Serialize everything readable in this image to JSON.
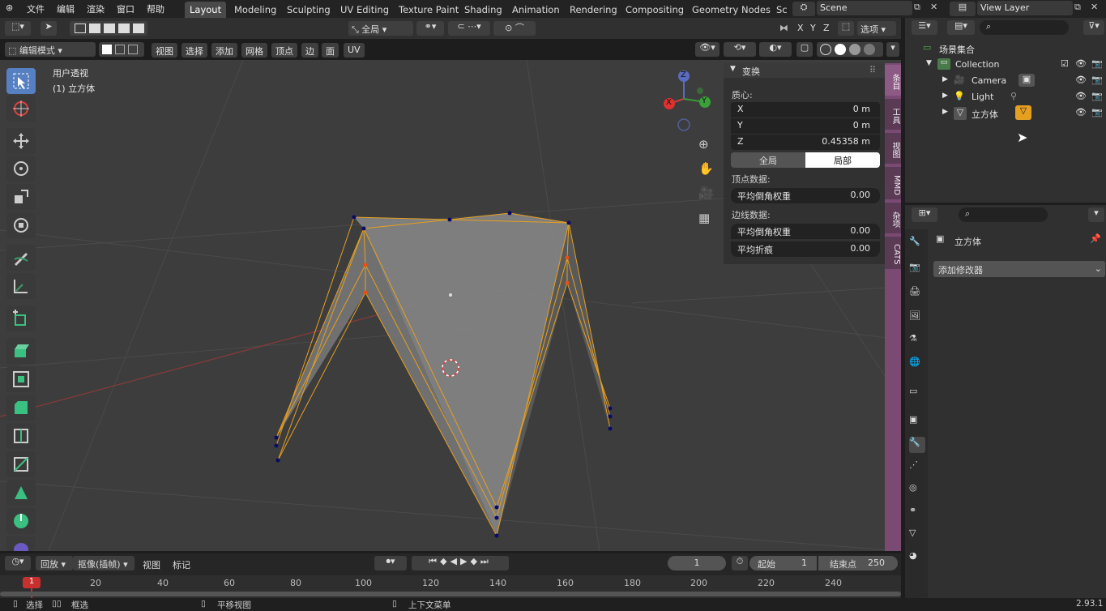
{
  "menu": {
    "file": "文件",
    "edit": "编辑",
    "render": "渲染",
    "window": "窗口",
    "help": "帮助"
  },
  "workspaces": [
    "Layout",
    "Modeling",
    "Sculpting",
    "UV Editing",
    "Texture Paint",
    "Shading",
    "Animation",
    "Rendering",
    "Compositing",
    "Geometry Nodes",
    "Sc"
  ],
  "scene": {
    "name": "Scene",
    "view_layer": "View Layer"
  },
  "viewport_header": {
    "orientation": "全局",
    "options": "选项",
    "mode": "编辑模式",
    "menus": [
      "视图",
      "选择",
      "添加",
      "网格",
      "顶点",
      "边",
      "面",
      "UV"
    ],
    "axes": [
      "X",
      "Y",
      "Z"
    ]
  },
  "viewport": {
    "view_name": "用户透视",
    "object_label": "(1) 立方体"
  },
  "gizmo": {
    "x": "X",
    "y": "Y",
    "z": "Z"
  },
  "npanel": {
    "title": "变换",
    "median_label": "质心:",
    "x_label": "X",
    "x_value": "0 m",
    "y_label": "Y",
    "y_value": "0 m",
    "z_label": "Z",
    "z_value": "0.45358 m",
    "global_btn": "全局",
    "local_btn": "局部",
    "vertex_data": "顶点数据:",
    "bevel_weight_v_label": "平均倒角权重",
    "bevel_weight_v": "0.00",
    "edge_data": "边线数据:",
    "bevel_weight_e_label": "平均倒角权重",
    "bevel_weight_e": "0.00",
    "crease_label": "平均折痕",
    "crease": "0.00"
  },
  "side_tabs": [
    "条目",
    "工具",
    "视图",
    "MMD",
    "杂项",
    "CATS"
  ],
  "outliner": {
    "root": "场景集合",
    "collection": "Collection",
    "items": [
      "Camera",
      "Light",
      "立方体"
    ]
  },
  "properties": {
    "object_name": "立方体",
    "add_modifier": "添加修改器"
  },
  "timeline": {
    "playback": "回放",
    "keying": "抠像(插帧)",
    "view": "视图",
    "marker": "标记",
    "current_frame": "1",
    "start_label": "起始",
    "start": "1",
    "end_label": "结束点",
    "end": "250",
    "ruler_marks": [
      "20",
      "40",
      "60",
      "80",
      "100",
      "120",
      "140",
      "160",
      "180",
      "200",
      "220",
      "240"
    ],
    "playhead": "1"
  },
  "statusbar": {
    "select": "选择",
    "box_select": "框选",
    "pan_view": "平移视图",
    "context_menu": "上下文菜单",
    "version": "2.93.1"
  },
  "colors": {
    "accent": "#5680c2",
    "outline": "#e6a020",
    "sidebar_tab": "#7b4a73"
  }
}
